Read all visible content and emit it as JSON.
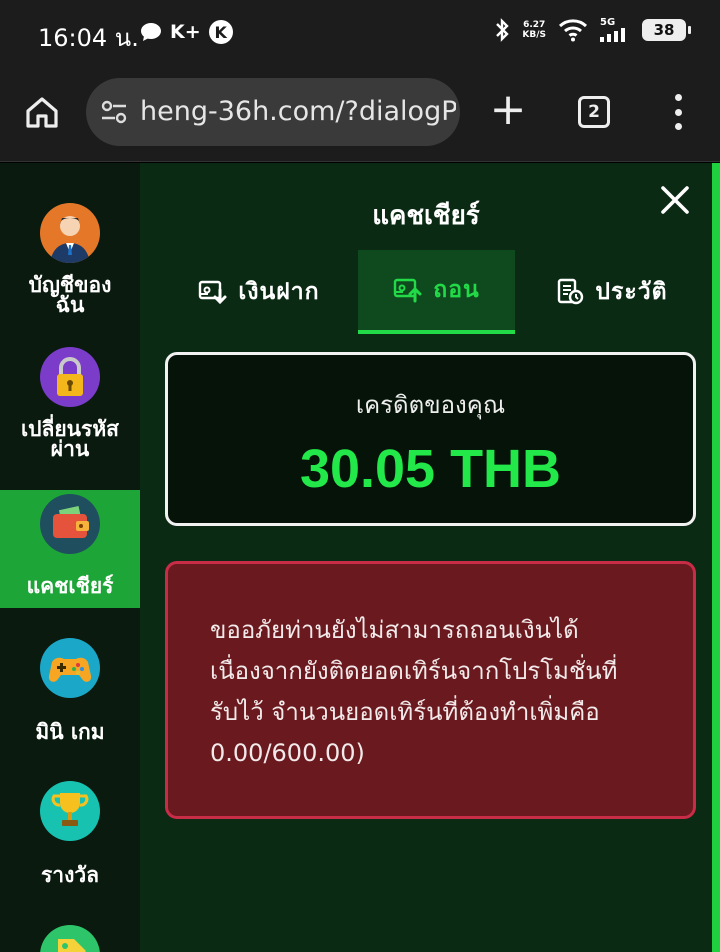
{
  "status_bar": {
    "time": "16:04 น.",
    "left_indicators": [
      "K+",
      "K"
    ],
    "net_speed_value": "6.27",
    "net_speed_unit": "KB/S",
    "network": "5G",
    "battery": "38"
  },
  "browser": {
    "url": "heng-36h.com/?dialogPr",
    "tab_count": "2"
  },
  "sidebar": {
    "items": [
      {
        "label": "บัญชีของฉัน",
        "icon": "account-avatar-icon"
      },
      {
        "label": "เปลี่ยนรหัสผ่าน",
        "icon": "padlock-icon"
      },
      {
        "label": "แคชเชียร์",
        "icon": "wallet-icon",
        "active": true
      },
      {
        "label": "มินิ เกม",
        "icon": "gamepad-icon"
      },
      {
        "label": "รางวัล",
        "icon": "trophy-icon"
      }
    ]
  },
  "dialog": {
    "title": "แคชเชียร์",
    "tabs": [
      {
        "label": "เงินฝาก",
        "icon": "deposit-icon"
      },
      {
        "label": "ถอน",
        "icon": "withdraw-icon",
        "active": true
      },
      {
        "label": "ประวัติ",
        "icon": "history-icon"
      }
    ],
    "credit_label": "เครดิตของคุณ",
    "credit_amount": "30.05 THB",
    "error_lines": [
      "ขออภัยท่านยังไม่สามารถถอนเงินได้",
      "เนื่องจากยังติดยอดเทิร์นจากโปรโมชั่นที่",
      "รับไว้ จำนวนยอดเทิร์นที่ต้องทำเพิ่มคือ",
      "0.00/600.00)"
    ]
  },
  "colors": {
    "accent": "#22d947",
    "sidebar_active": "#1ea537",
    "error_bg": "#6a1a1f",
    "error_border": "#c92c46"
  }
}
